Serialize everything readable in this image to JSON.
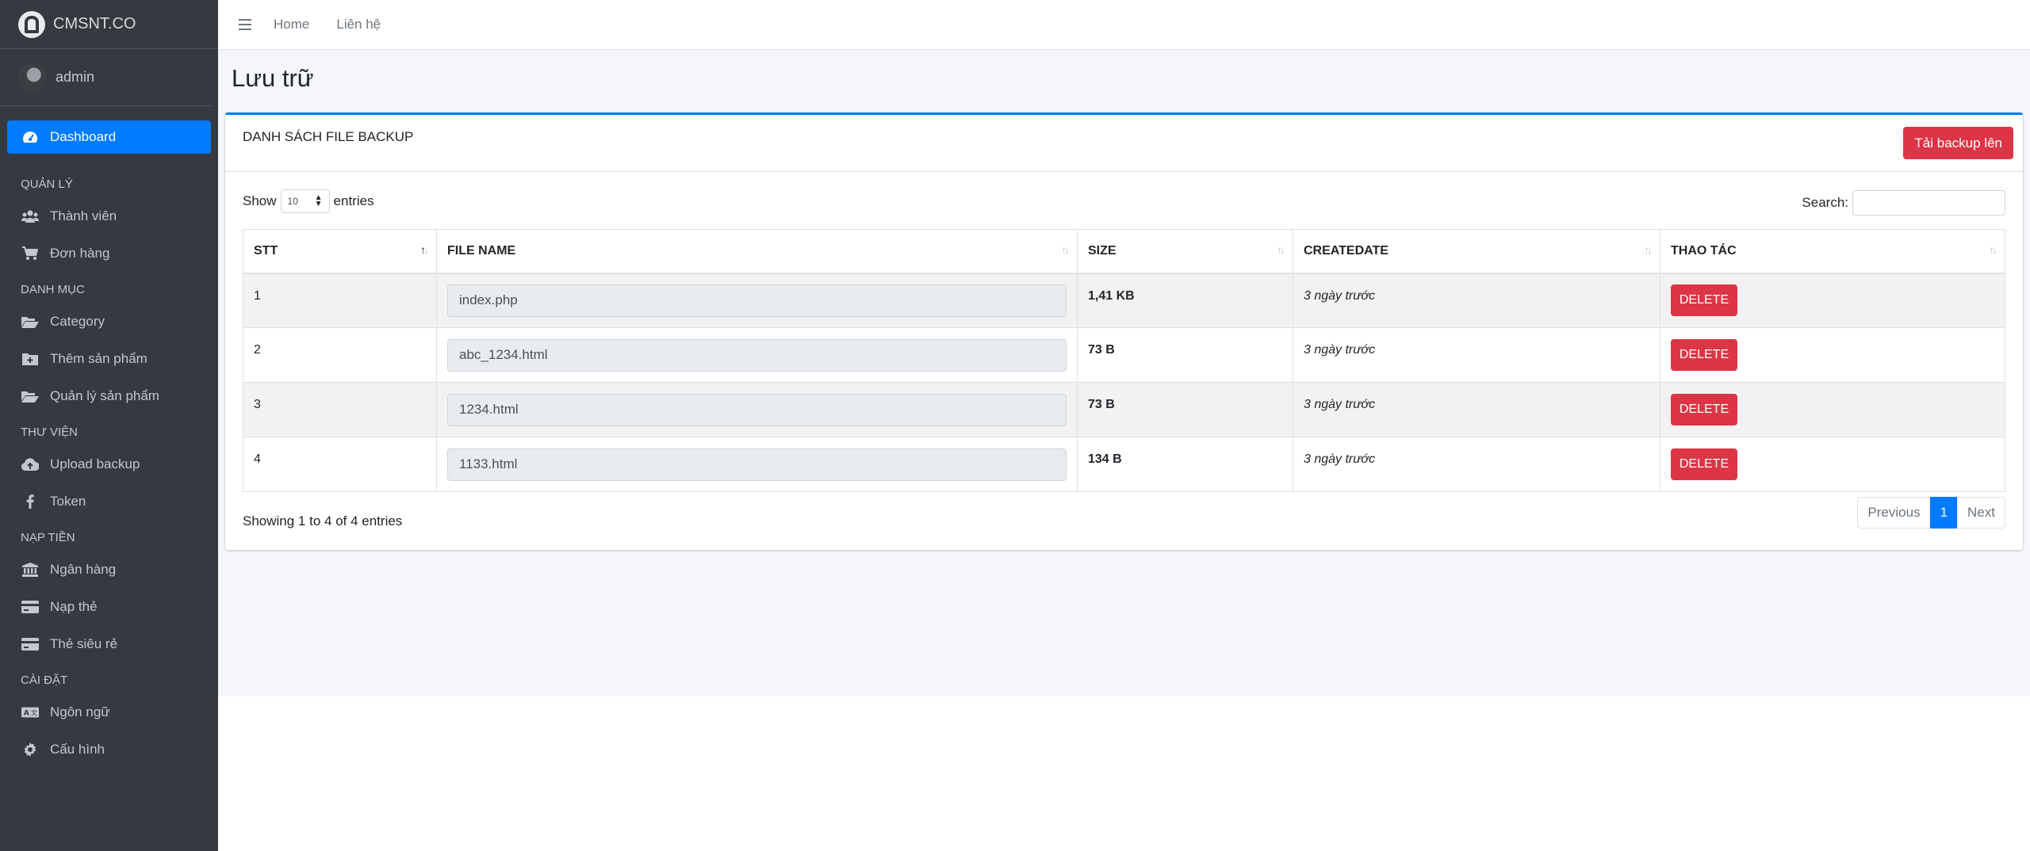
{
  "brand": {
    "name": "CMSNT.CO"
  },
  "user": {
    "name": "admin"
  },
  "sidebar": {
    "dashboard": {
      "label": "Dashboard",
      "icon": "tachometer-icon"
    },
    "sections": [
      {
        "header": "QUẢN LÝ",
        "items": [
          {
            "label": "Thành viên",
            "icon": "users-icon"
          },
          {
            "label": "Đơn hàng",
            "icon": "cart-icon"
          }
        ]
      },
      {
        "header": "DANH MỤC",
        "items": [
          {
            "label": "Category",
            "icon": "folder-open-icon"
          },
          {
            "label": "Thêm sản phẩm",
            "icon": "folder-plus-icon"
          },
          {
            "label": "Quản lý sản phẩm",
            "icon": "folder-open-icon"
          }
        ]
      },
      {
        "header": "THƯ VIỆN",
        "items": [
          {
            "label": "Upload backup",
            "icon": "cloud-upload-icon"
          },
          {
            "label": "Token",
            "icon": "facebook-icon"
          }
        ]
      },
      {
        "header": "NẠP TIỀN",
        "items": [
          {
            "label": "Ngân hàng",
            "icon": "bank-icon"
          },
          {
            "label": "Nạp thẻ",
            "icon": "credit-card-icon"
          },
          {
            "label": "Thẻ siêu rẻ",
            "icon": "credit-card-icon"
          }
        ]
      },
      {
        "header": "CÀI ĐẶT",
        "items": [
          {
            "label": "Ngôn ngữ",
            "icon": "language-icon"
          },
          {
            "label": "Cấu hình",
            "icon": "gear-icon"
          }
        ]
      }
    ]
  },
  "topnav": {
    "home": "Home",
    "contact": "Liên hệ"
  },
  "page": {
    "title": "Lưu trữ"
  },
  "card": {
    "title": "DANH SÁCH FILE BACKUP",
    "upload_button": "Tải backup lên"
  },
  "table_controls": {
    "show_label": "Show",
    "page_length": "10",
    "entries_label": "entries",
    "search_label": "Search:",
    "search_value": ""
  },
  "table": {
    "columns": [
      "STT",
      "FILE NAME",
      "SIZE",
      "CREATEDATE",
      "THAO TÁC"
    ],
    "rows": [
      {
        "stt": "1",
        "file_name": "index.php",
        "size": "1,41 KB",
        "created": "3 ngày trước",
        "action": "DELETE"
      },
      {
        "stt": "2",
        "file_name": "abc_1234.html",
        "size": "73 B",
        "created": "3 ngày trước",
        "action": "DELETE"
      },
      {
        "stt": "3",
        "file_name": "1234.html",
        "size": "73 B",
        "created": "3 ngày trước",
        "action": "DELETE"
      },
      {
        "stt": "4",
        "file_name": "1133.html",
        "size": "134 B",
        "created": "3 ngày trước",
        "action": "DELETE"
      }
    ]
  },
  "footer_info": "Showing 1 to 4 of 4 entries",
  "pagination": {
    "previous": "Previous",
    "current": "1",
    "next": "Next"
  },
  "colors": {
    "primary": "#007bff",
    "danger": "#dc3545",
    "sidebar": "#343a40",
    "content_bg": "#f4f6f9"
  }
}
